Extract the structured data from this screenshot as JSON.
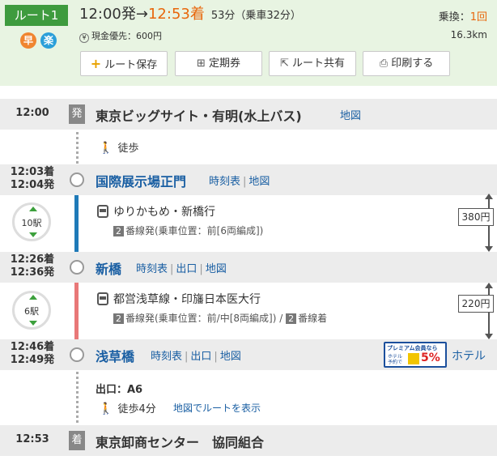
{
  "header": {
    "route_label": "ルート1",
    "badges": [
      "早",
      "楽"
    ],
    "depart": "12:00発",
    "arrow": "→",
    "arrive": "12:53着",
    "duration": "53分（乗車32分）",
    "transfer_label": "乗換：",
    "transfer_count": "1回",
    "yen_symbol": "¥",
    "fare_note": "現金優先：600円",
    "distance": "16.3km",
    "buttons": {
      "save": "ルート保存",
      "pass": "定期券",
      "share": "ルート共有",
      "print": "印刷する"
    }
  },
  "stations": [
    {
      "time": "12:00",
      "tag": "発",
      "name": "東京ビッグサイト・有明(水上バス)",
      "links": [
        "地図"
      ]
    },
    {
      "time_arr": "12:03着",
      "time_dep": "12:04発",
      "name": "国際展示場正門",
      "links": [
        "時刻表",
        "地図"
      ]
    },
    {
      "time_arr": "12:26着",
      "time_dep": "12:36発",
      "name": "新橋",
      "links": [
        "時刻表",
        "出口",
        "地図"
      ]
    },
    {
      "time_arr": "12:46着",
      "time_dep": "12:49発",
      "name": "浅草橋",
      "links": [
        "時刻表",
        "出口",
        "地図"
      ]
    },
    {
      "time": "12:53",
      "tag": "着",
      "name": "東京卸商センター　協同組合"
    }
  ],
  "walk_text": "徒歩",
  "segments": [
    {
      "stops": "10駅",
      "line": "ゆりかもめ・新橋行",
      "platform_num": "2",
      "platform": "番線発(乗車位置：前[6両編成])",
      "fare": "380円",
      "color": "#1f7ab8"
    },
    {
      "stops": "6駅",
      "line": "都営浅草線・印旛日本医大行",
      "platform_num": "2",
      "platform": "番線発(乗車位置：前/中[8両編成])",
      "sep": " / ",
      "platform2_num": "2",
      "platform2": "番線着",
      "fare": "220円",
      "color": "#e87878"
    }
  ],
  "premium": {
    "line1": "プレミアム会員なら",
    "line2": "ホテル予約で",
    "pct": "5%"
  },
  "hotel_link": "ホテル",
  "exit": "出口：A6",
  "final_walk": "徒歩4分",
  "route_map_link": "地図でルートを表示",
  "icons": [
    "fast-badge-icon",
    "easy-badge-icon",
    "plus-icon",
    "pass-icon",
    "share-icon",
    "printer-icon",
    "walk-icon",
    "train-icon",
    "up-arrow-icon",
    "down-arrow-icon"
  ]
}
